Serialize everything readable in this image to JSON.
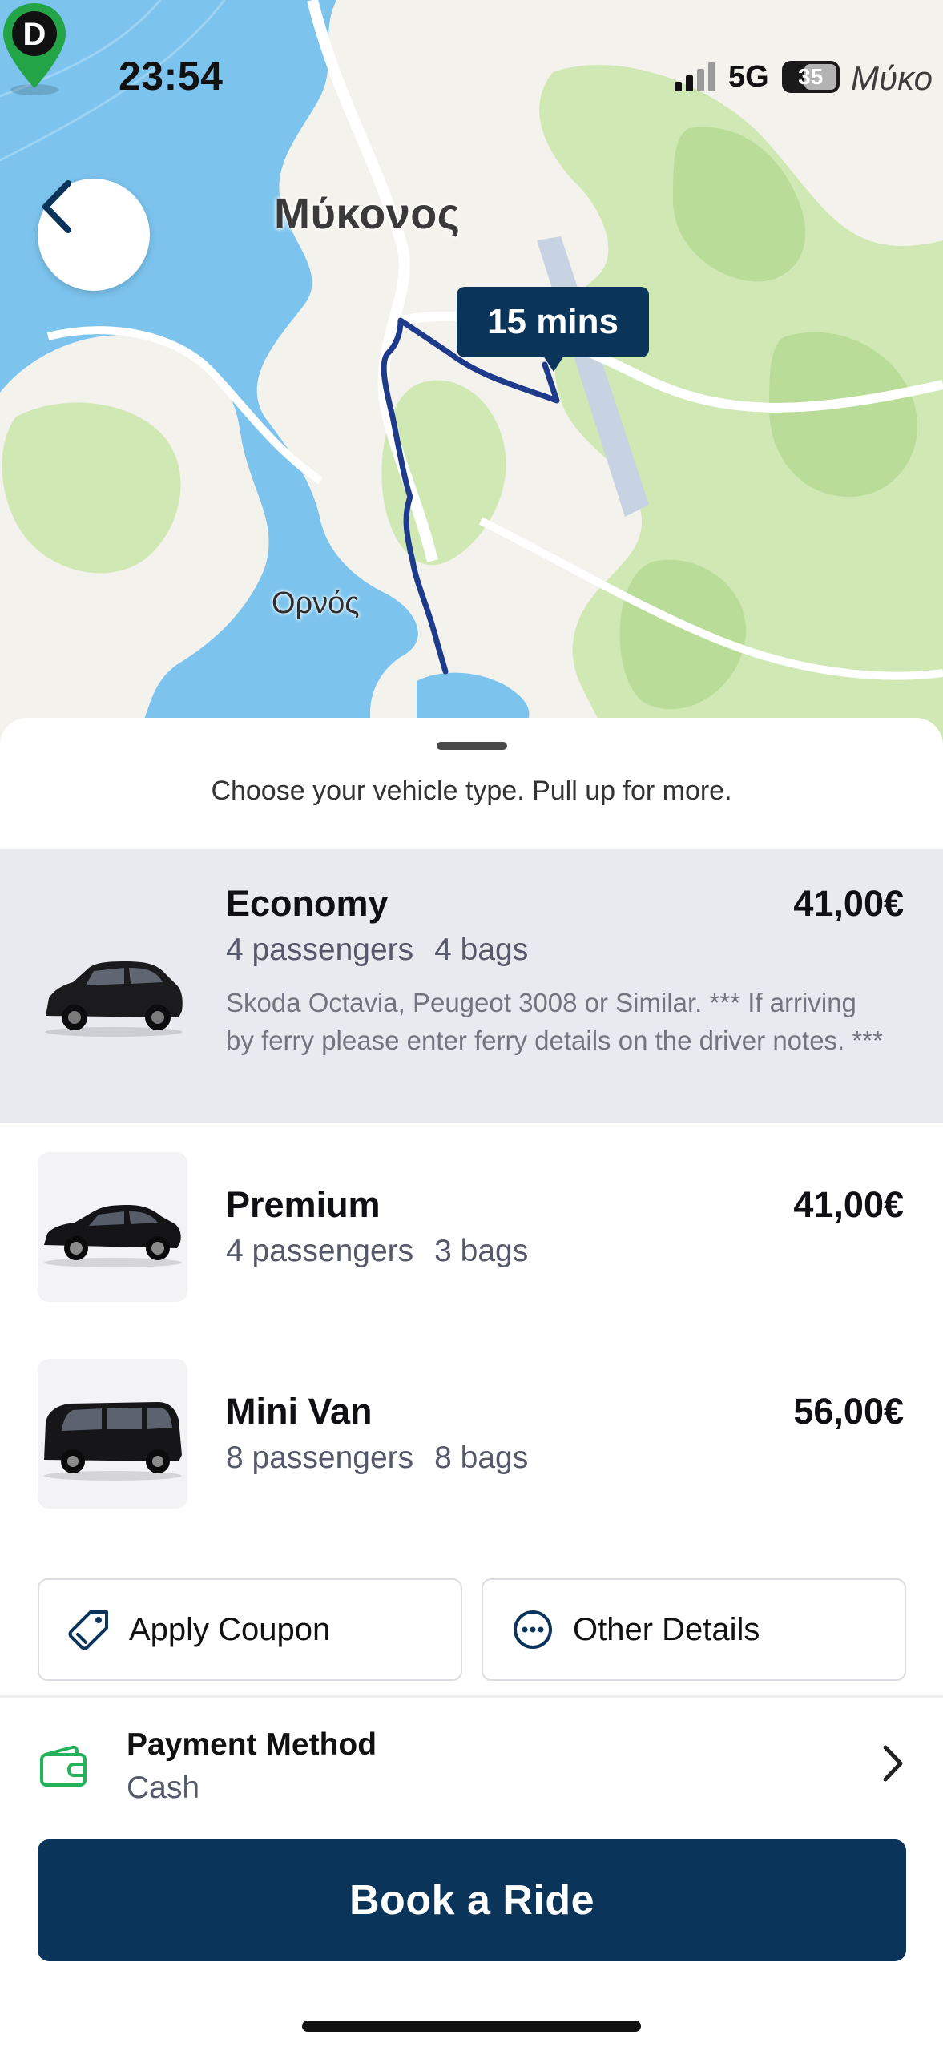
{
  "status_bar": {
    "time": "23:54",
    "network": "5G",
    "battery": "35"
  },
  "map": {
    "town_main": "Μύκονος",
    "town_secondary": "Ορνός",
    "town_edge": "Μύκο",
    "eta": "15 mins",
    "pin_label": "D",
    "colors": {
      "sea": "#7cc4ee",
      "route": "#1e3a8a",
      "pin": "#22a447"
    }
  },
  "sheet": {
    "hint": "Choose your vehicle type. Pull up for more."
  },
  "vehicles": [
    {
      "name": "Economy",
      "price": "41,00€",
      "passengers": "4 passengers",
      "bags": "4 bags",
      "description": "Skoda Octavia, Peugeot 3008  or Similar. *** If arriving by ferry please enter ferry details on the driver notes. ***",
      "selected": true,
      "icon": "suv-car-image"
    },
    {
      "name": "Premium",
      "price": "41,00€",
      "passengers": "4 passengers",
      "bags": "3 bags",
      "selected": false,
      "icon": "sedan-car-image"
    },
    {
      "name": "Mini Van",
      "price": "56,00€",
      "passengers": "8 passengers",
      "bags": "8 bags",
      "selected": false,
      "icon": "van-car-image"
    }
  ],
  "actions": {
    "coupon_label": "Apply Coupon",
    "details_label": "Other Details"
  },
  "payment": {
    "title": "Payment Method",
    "value": "Cash"
  },
  "book_label": "Book a Ride",
  "theme": {
    "primary": "#0b345a",
    "selected_bg": "#e9eaef",
    "wallet_green": "#22b35a"
  }
}
